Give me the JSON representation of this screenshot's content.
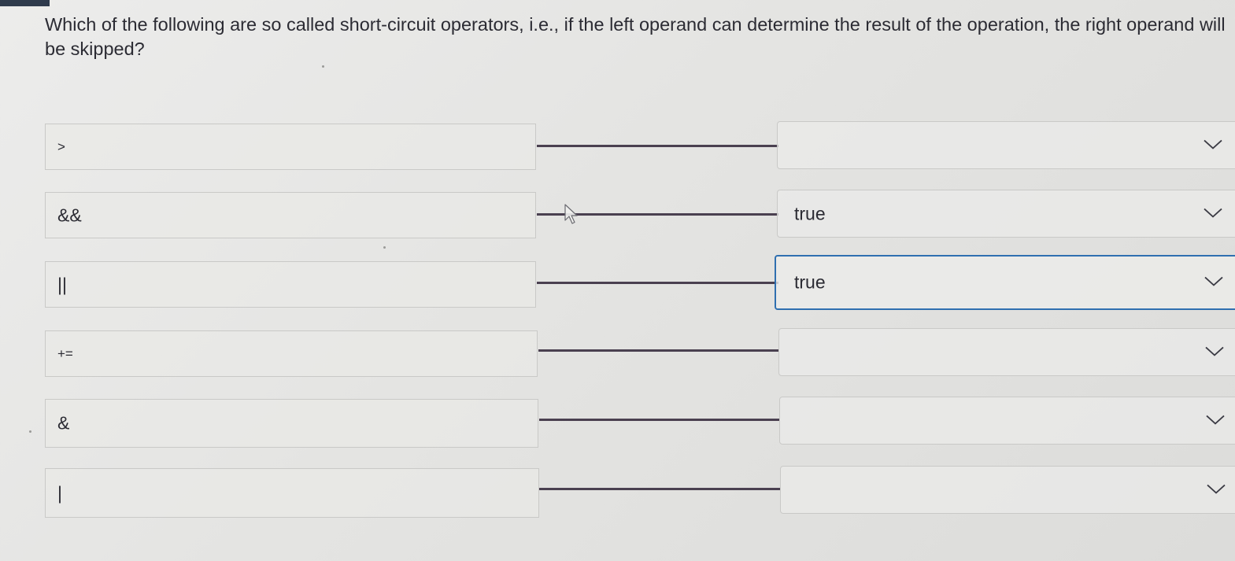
{
  "question": "Which of the following are so called short-circuit operators, i.e., if the left operand can determine the result of the operation, the right operand will be skipped?",
  "rows": [
    {
      "operator": ">",
      "answer": ""
    },
    {
      "operator": "&&",
      "answer": "true"
    },
    {
      "operator": "||",
      "answer": "true"
    },
    {
      "operator": "+=",
      "answer": ""
    },
    {
      "operator": "&",
      "answer": ""
    },
    {
      "operator": "|",
      "answer": ""
    }
  ],
  "icons": {
    "dropdown": "chevron-down-icon",
    "cursor": "mouse-pointer-icon"
  },
  "colors": {
    "focus_border": "#2f6fb0",
    "connector": "#4a4050",
    "background": "#e6e6e4"
  }
}
